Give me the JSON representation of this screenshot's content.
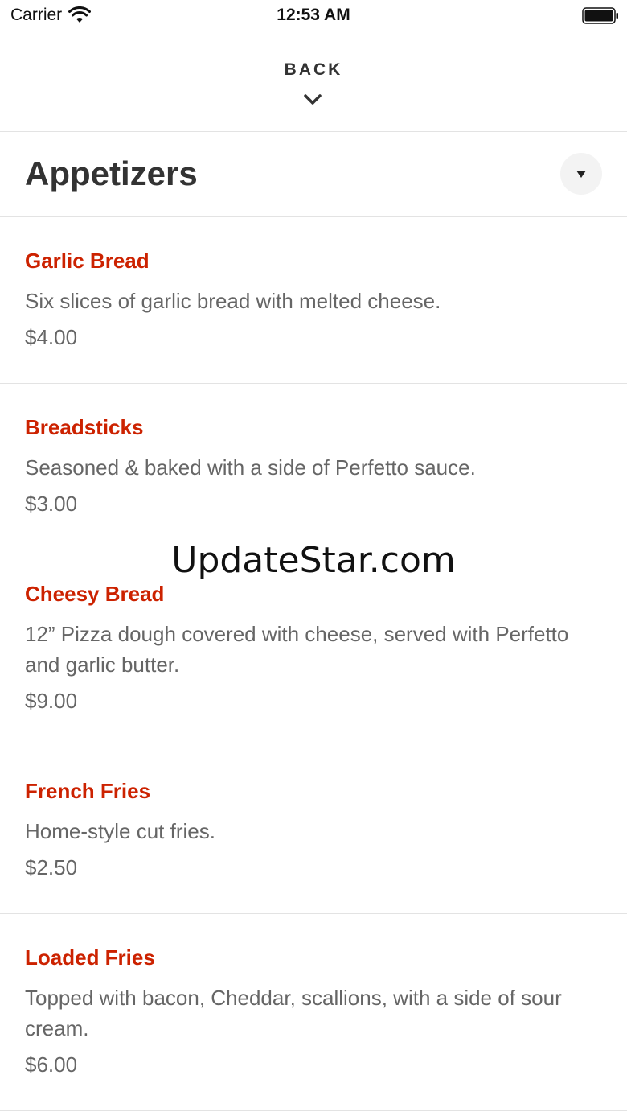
{
  "status_bar": {
    "carrier": "Carrier",
    "time": "12:53 AM"
  },
  "header": {
    "back_label": "BACK"
  },
  "section": {
    "title": "Appetizers"
  },
  "items": [
    {
      "name": "Garlic Bread",
      "description": "Six slices of garlic bread with melted cheese.",
      "price": "$4.00"
    },
    {
      "name": "Breadsticks",
      "description": "Seasoned & baked with a side of Perfetto sauce.",
      "price": "$3.00"
    },
    {
      "name": "Cheesy Bread",
      "description": "12” Pizza dough covered with cheese, served with Perfetto and garlic butter.",
      "price": "$9.00"
    },
    {
      "name": "French Fries",
      "description": "Home-style cut fries.",
      "price": "$2.50"
    },
    {
      "name": "Loaded Fries",
      "description": "Topped with bacon, Cheddar, scallions, with a side of sour cream.",
      "price": "$6.00"
    }
  ],
  "watermark": "UpdateStar.com",
  "colors": {
    "item_name": "#cc2200",
    "text_secondary": "#666666",
    "divider": "#e3e3e3"
  }
}
